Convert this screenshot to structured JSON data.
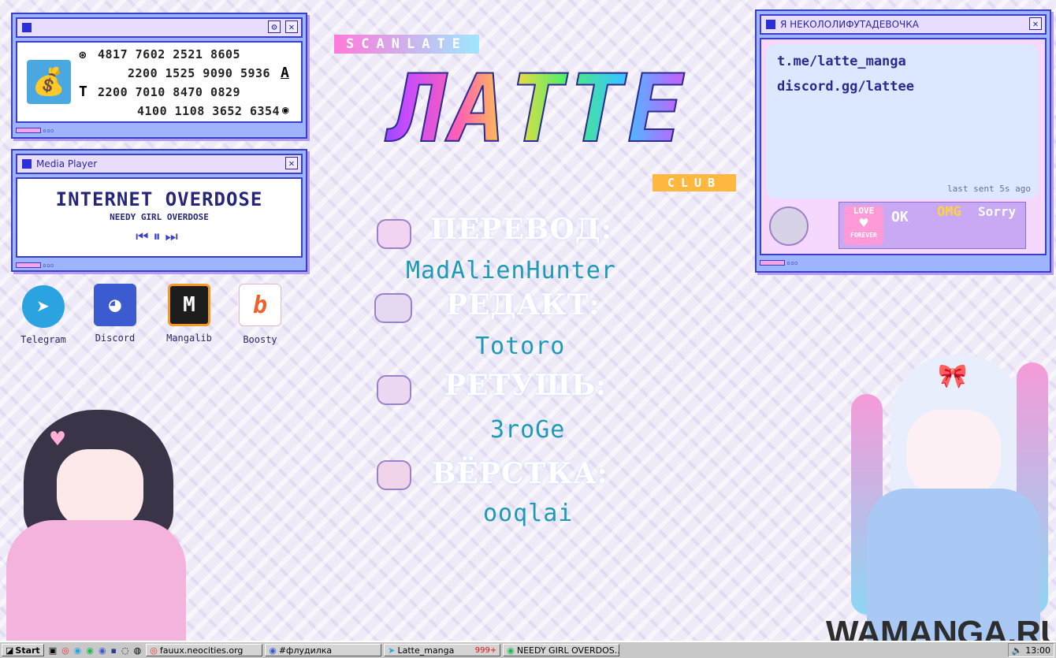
{
  "card_window": {
    "lines": [
      "4817 7602 2521 8605",
      "2200 1525 9090 5936",
      "2200 7010 8470 0829",
      "4100 1108 3652 6354"
    ]
  },
  "media_player": {
    "title": "Media Player",
    "track": "INTERNET OVERDOSE",
    "artist": "NEEDY GIRL OVERDOSE"
  },
  "desktop_icons": [
    {
      "label": "Telegram",
      "color": "#2aa3e0"
    },
    {
      "label": "Discord",
      "color": "#3d5bd1"
    },
    {
      "label": "Mangalib",
      "color": "#1d1d1d"
    },
    {
      "label": "Boosty",
      "color": "#f15f2c"
    }
  ],
  "logo": {
    "top": "SCANLATE",
    "main": "ЛАТТЕ",
    "bottom": "CLUB"
  },
  "credits": [
    {
      "role": "ПЕРЕВОД:",
      "name": "MadAlienHunter"
    },
    {
      "role": "РЕДАКТ:",
      "name": "Totoro"
    },
    {
      "role": "РЕТУШЬ:",
      "name": "3roGe"
    },
    {
      "role": "ВЁРСТКА:",
      "name": "ooqlai"
    }
  ],
  "chat_window": {
    "title": "Я НЕКОЛОЛИФУТАДЕВОЧКА",
    "links": [
      "t.me/latte_manga",
      "discord.gg/lattee"
    ],
    "status": "last sent 5s ago",
    "stickers": [
      "LOVE",
      "OK",
      "OMG",
      "Sorry"
    ],
    "sticker_sub": "FOREVER"
  },
  "watermark": "WAMANGA.RU",
  "taskbar": {
    "start": "Start",
    "tasks": [
      "fauux.neocities.org",
      "#флудилка",
      "Latte_manga",
      "NEEDY GIRL OVERDOS..."
    ],
    "badge": "999+",
    "clock": "13:00"
  }
}
